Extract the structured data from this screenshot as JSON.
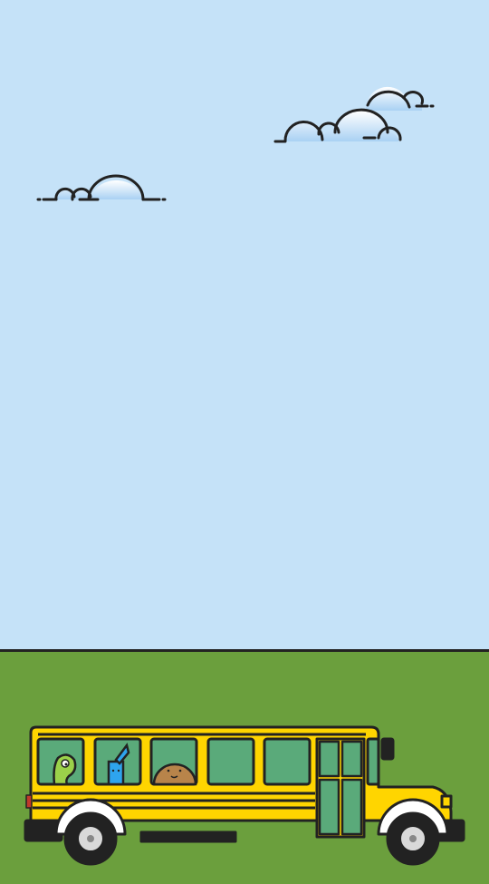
{
  "scene": {
    "sky_color": "#c5e2f8",
    "ground_color": "#6b9f3d",
    "outline_color": "#222222"
  },
  "bus": {
    "body_color": "#ffd500",
    "window_color": "#5aaa7a",
    "tire_color": "#222222",
    "hubcap_color": "#d9d9d9",
    "passengers": [
      "green-slime-character",
      "blue-milk-carton-character",
      "brown-cookie-character"
    ]
  },
  "icons": {
    "cloud_left": "cloud-icon",
    "cloud_right": "cloud-icon",
    "bus": "school-bus-icon"
  }
}
